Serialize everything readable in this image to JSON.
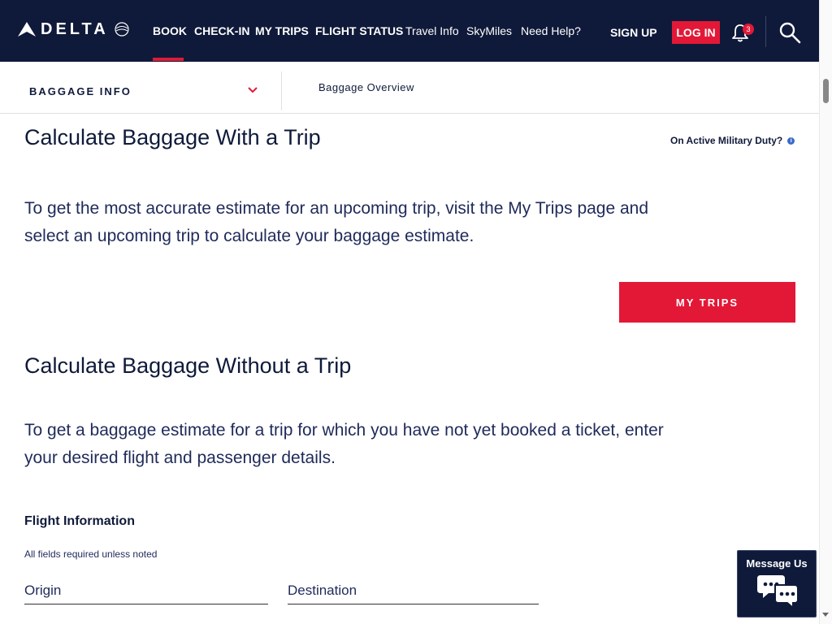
{
  "header": {
    "brand": "DELTA",
    "nav": [
      {
        "label": "BOOK"
      },
      {
        "label": "CHECK-IN"
      },
      {
        "label": "MY TRIPS"
      },
      {
        "label": "FLIGHT STATUS"
      },
      {
        "label": "Travel Info"
      },
      {
        "label": "SkyMiles"
      },
      {
        "label": "Need Help?"
      }
    ],
    "signup_label": "SIGN UP",
    "login_label": "LOG IN",
    "notifications_count": "3",
    "icons": {
      "bell": "bell-icon",
      "search": "search-icon"
    }
  },
  "subnav": {
    "section_title": "BAGGAGE INFO",
    "link": "Baggage Overview"
  },
  "with_trip": {
    "heading": "Calculate Baggage With a Trip",
    "military_link": "On Active Military Duty?",
    "description": "To get the most accurate estimate for an upcoming trip, visit the My Trips page and select an upcoming trip to calculate your baggage estimate.",
    "button_label": "MY TRIPS"
  },
  "without_trip": {
    "heading": "Calculate Baggage Without a Trip",
    "description": "To get a baggage estimate for a trip for which you have not yet booked a ticket, enter your desired flight and passenger details.",
    "flight_info_label": "Flight Information",
    "required_note": "All fields required unless noted",
    "origin_label": "Origin",
    "destination_label": "Destination"
  },
  "chat": {
    "label": "Message Us"
  },
  "colors": {
    "navy": "#0f1a3a",
    "red": "#e31837",
    "text": "#1f2a5a"
  }
}
